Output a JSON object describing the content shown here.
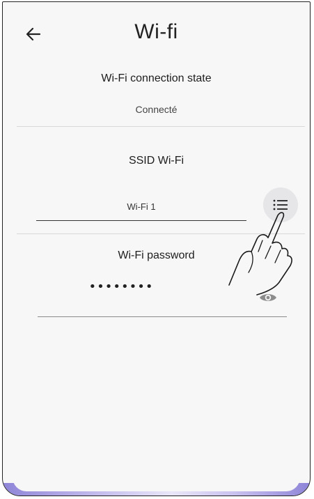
{
  "header": {
    "title": "Wi-fi",
    "back_icon": "arrow-left-icon"
  },
  "connection": {
    "label": "Wi-Fi connection state",
    "value": "Connecté"
  },
  "ssid": {
    "label": "SSID Wi-Fi",
    "value": "Wi-Fi 1",
    "list_icon": "list-icon"
  },
  "password": {
    "label": "Wi-Fi password",
    "masked_value": "••••••••",
    "visibility_icon": "eye-icon"
  },
  "overlay": {
    "hand_icon": "pointing-hand-icon"
  },
  "colors": {
    "background": "#f7f7f8",
    "text": "#222222",
    "divider": "#d8d8d8",
    "button_bg": "#e6e6e8",
    "accent_bottom": "#8f85d8"
  }
}
